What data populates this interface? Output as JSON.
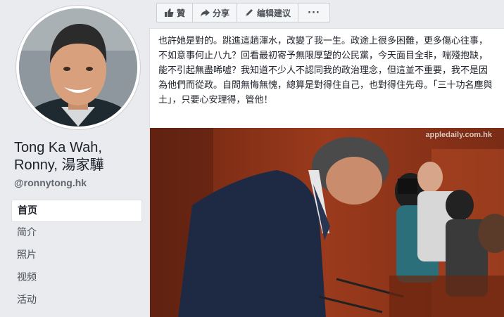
{
  "profile": {
    "name": "Tong Ka Wah, Ronny, 湯家驊",
    "handle": "@ronnytong.hk"
  },
  "nav": {
    "items": [
      {
        "label": "首页",
        "active": true
      },
      {
        "label": "简介",
        "active": false
      },
      {
        "label": "照片",
        "active": false
      },
      {
        "label": "视频",
        "active": false
      },
      {
        "label": "活动",
        "active": false
      }
    ]
  },
  "toolbar": {
    "like_label": "贊",
    "share_label": "分享",
    "suggest_edit_label": "编辑建议",
    "more_label": "···"
  },
  "post": {
    "text": "也許她是對的。跳進這趟渾水，改變了我一生。政途上很多困難，更多傷心往事，不如意事何止八九？回看最初寄予無限厚望的公民黨，今天面目全非，喘殘抱缺，能不引起無盡唏噓？我知道不少人不認同我的政治理念，但這並不重要，我不是因為他們而從政。自問無悔無愧，總算是對得住自己，也對得住先母。「三十功名塵與土」，只要心安理得，管他！",
    "photo_watermark": "appledaily.com.hk"
  },
  "colors": {
    "page_bg": "#e9ebee",
    "text_primary": "#1d2129",
    "text_secondary": "#606770"
  }
}
